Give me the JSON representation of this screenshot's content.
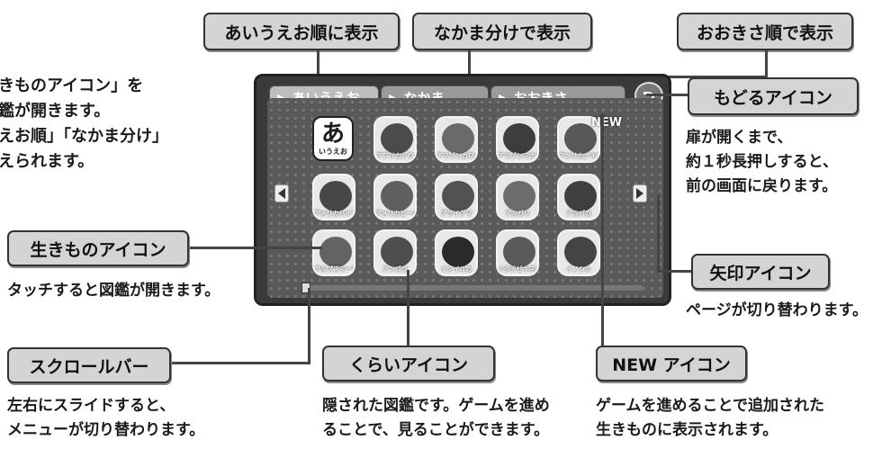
{
  "labels": {
    "aiueo_order": "あいうえお順に表示",
    "group_view": "なかま分けで表示",
    "size_order": "おおきさ順で表示",
    "back_icon": "もどるアイコン",
    "creature_icon": "生きものアイコン",
    "arrow_icon": "矢印アイコン",
    "scroll_bar": "スクロールバー",
    "dark_icon": "くらいアイコン",
    "new_icon": "NEW アイコン"
  },
  "descriptions": {
    "intro": [
      "きものアイコン」を",
      "鑑が開きます。",
      "えお順」「なかま分け」",
      "えられます。"
    ],
    "creature": [
      "タッチすると図鑑が開きます。"
    ],
    "back": [
      "扉が開くまで、",
      "約１秒長押しすると、",
      "前の画面に戻ります。"
    ],
    "arrow": [
      "ページが切り替わります。"
    ],
    "scroll": [
      "左右にスライドすると、",
      "メニューが切り替わります。"
    ],
    "dark": [
      "隠された図鑑です。ゲームを進め",
      "ることで、見ることができます。"
    ],
    "new": [
      "ゲームを進めることで追加された",
      "生きものに表示されます。"
    ]
  },
  "screen": {
    "tabs": [
      "あいうえお",
      "なかま",
      "おおきさ"
    ],
    "back_label": "もどる",
    "new_badge": "NEW",
    "aiueo_tile": {
      "char": "あ",
      "sub": "いうえお"
    },
    "animals": [
      "アフリカゾウ",
      "アマゾンカワイルカ",
      "アマゾンマナティー",
      "アメリカナキウサギ",
      "アメリカバイソン (バッファロー)",
      "アメリカビーバー",
      "アライグマ",
      "アルガリ",
      "アルパカ",
      "アルプスマーモット (マーモット)",
      "アンゴラ",
      "イシイルカ",
      "イタチビキネズミ",
      "イノシシ"
    ]
  },
  "colors": {
    "label_bg": "#d4d4d4",
    "screen_bg": "#3a3a3a",
    "line": "#444444"
  }
}
